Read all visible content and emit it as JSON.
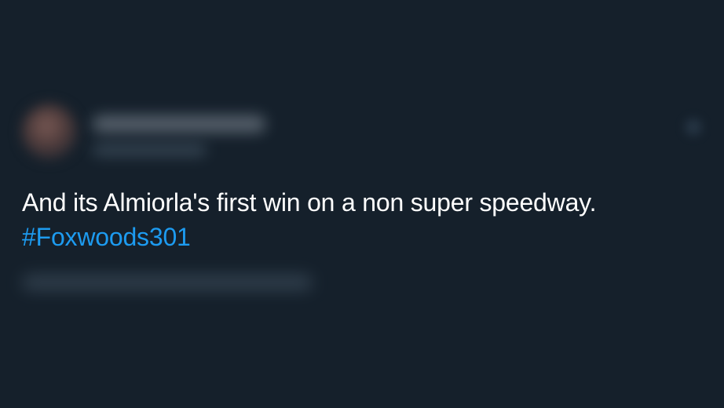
{
  "tweet": {
    "text": "And its Almiorla's first win on a non super speedway.",
    "hashtag": "#Foxwoods301"
  },
  "colors": {
    "background": "#15202b",
    "text": "#ffffff",
    "link": "#1d9bf0"
  },
  "icons": {
    "avatar": "user-avatar",
    "menu": "more-options-icon"
  }
}
